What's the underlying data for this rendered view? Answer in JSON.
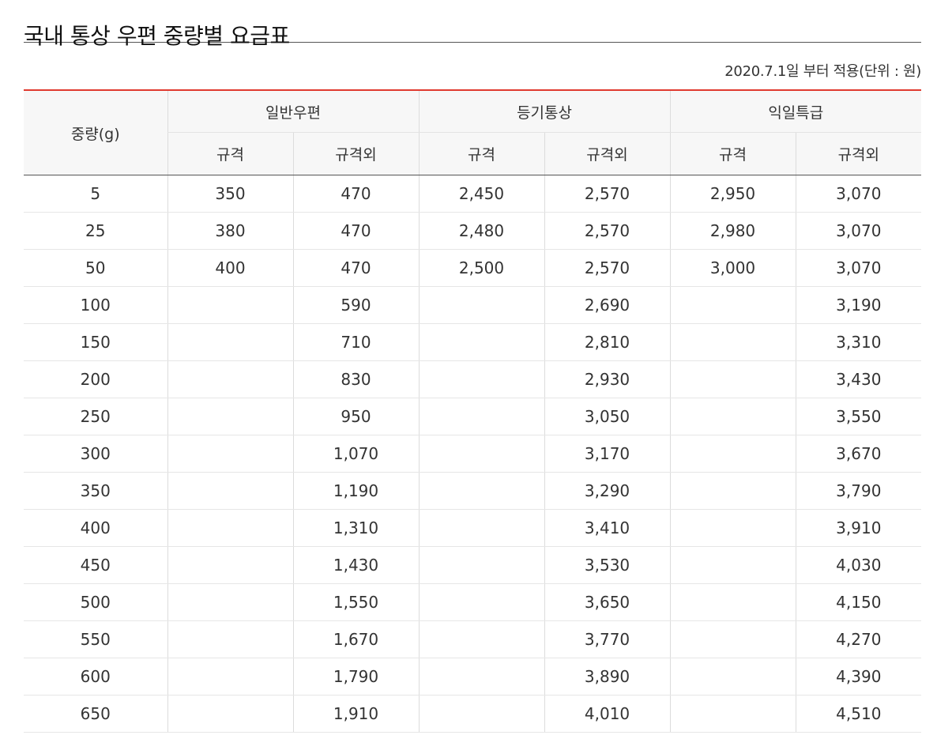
{
  "title": "국내 통상 우편 중량별 요금표",
  "note": "2020.7.1일 부터 적용(단위 : 원)",
  "table": {
    "weight_header": "중량(g)",
    "groups": [
      {
        "label": "일반우편",
        "sub": [
          "규격",
          "규격외"
        ]
      },
      {
        "label": "등기통상",
        "sub": [
          "규격",
          "규격외"
        ]
      },
      {
        "label": "익일특급",
        "sub": [
          "규격",
          "규격외"
        ]
      }
    ],
    "rows": [
      [
        "5",
        "350",
        "470",
        "2,450",
        "2,570",
        "2,950",
        "3,070"
      ],
      [
        "25",
        "380",
        "470",
        "2,480",
        "2,570",
        "2,980",
        "3,070"
      ],
      [
        "50",
        "400",
        "470",
        "2,500",
        "2,570",
        "3,000",
        "3,070"
      ],
      [
        "100",
        "",
        "590",
        "",
        "2,690",
        "",
        "3,190"
      ],
      [
        "150",
        "",
        "710",
        "",
        "2,810",
        "",
        "3,310"
      ],
      [
        "200",
        "",
        "830",
        "",
        "2,930",
        "",
        "3,430"
      ],
      [
        "250",
        "",
        "950",
        "",
        "3,050",
        "",
        "3,550"
      ],
      [
        "300",
        "",
        "1,070",
        "",
        "3,170",
        "",
        "3,670"
      ],
      [
        "350",
        "",
        "1,190",
        "",
        "3,290",
        "",
        "3,790"
      ],
      [
        "400",
        "",
        "1,310",
        "",
        "3,410",
        "",
        "3,910"
      ],
      [
        "450",
        "",
        "1,430",
        "",
        "3,530",
        "",
        "4,030"
      ],
      [
        "500",
        "",
        "1,550",
        "",
        "3,650",
        "",
        "4,150"
      ],
      [
        "550",
        "",
        "1,670",
        "",
        "3,770",
        "",
        "4,270"
      ],
      [
        "600",
        "",
        "1,790",
        "",
        "3,890",
        "",
        "4,390"
      ],
      [
        "650",
        "",
        "1,910",
        "",
        "4,010",
        "",
        "4,510"
      ]
    ]
  },
  "colors": {
    "accent_line": "#e03a2f",
    "header_bg": "#f7f7f7",
    "text": "#333333"
  }
}
